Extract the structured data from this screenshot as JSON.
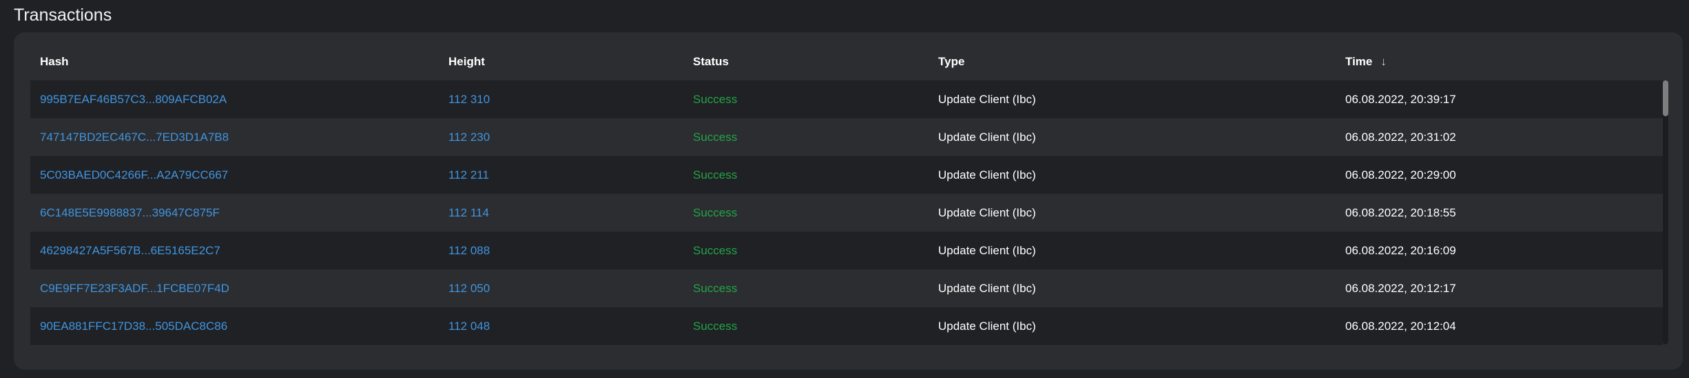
{
  "title": "Transactions",
  "columns": [
    "Hash",
    "Height",
    "Status",
    "Type",
    "Time"
  ],
  "sort": {
    "column": "Time",
    "direction": "desc",
    "icon": "arrow-down-icon"
  },
  "colors": {
    "link": "#3f95e0",
    "success": "#22a447",
    "background": "#202125",
    "card": "#2c2d30"
  },
  "rows": [
    {
      "hash": "995B7EAF46B57C3...809AFCB02A",
      "height": "112 310",
      "status": "Success",
      "type": "Update Client (Ibc)",
      "time": "06.08.2022, 20:39:17"
    },
    {
      "hash": "747147BD2EC467C...7ED3D1A7B8",
      "height": "112 230",
      "status": "Success",
      "type": "Update Client (Ibc)",
      "time": "06.08.2022, 20:31:02"
    },
    {
      "hash": "5C03BAED0C4266F...A2A79CC667",
      "height": "112 211",
      "status": "Success",
      "type": "Update Client (Ibc)",
      "time": "06.08.2022, 20:29:00"
    },
    {
      "hash": "6C148E5E9988837...39647C875F",
      "height": "112 114",
      "status": "Success",
      "type": "Update Client (Ibc)",
      "time": "06.08.2022, 20:18:55"
    },
    {
      "hash": "46298427A5F567B...6E5165E2C7",
      "height": "112 088",
      "status": "Success",
      "type": "Update Client (Ibc)",
      "time": "06.08.2022, 20:16:09"
    },
    {
      "hash": "C9E9FF7E23F3ADF...1FCBE07F4D",
      "height": "112 050",
      "status": "Success",
      "type": "Update Client (Ibc)",
      "time": "06.08.2022, 20:12:17"
    },
    {
      "hash": "90EA881FFC17D38...505DAC8C86",
      "height": "112 048",
      "status": "Success",
      "type": "Update Client (Ibc)",
      "time": "06.08.2022, 20:12:04"
    }
  ]
}
